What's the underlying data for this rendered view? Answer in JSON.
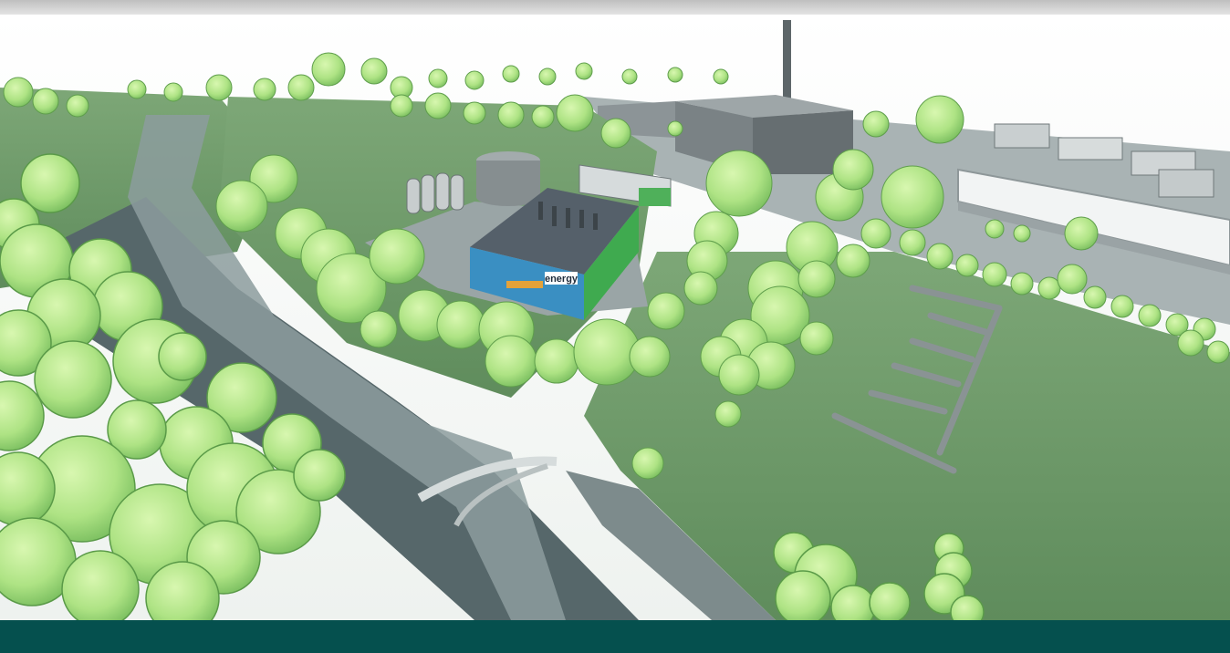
{
  "illustration": {
    "building_sign": "energy"
  },
  "colors": {
    "top_strip": "#d6d6d6",
    "sky": "#ffffff",
    "grass": "#6f9c6a",
    "grass_dark": "#557f55",
    "path": "#8a9a9a",
    "water": "#5a6a6a",
    "tree_light": "#b8ec92",
    "tree_mid": "#98d874",
    "tree_shadow": "#6cae58",
    "building_roof": "#5a6468",
    "building_wall": "#7c8488",
    "building_accent_green": "#3fae4e",
    "building_accent_blue": "#2e6fa8",
    "footer": "#05504e"
  }
}
